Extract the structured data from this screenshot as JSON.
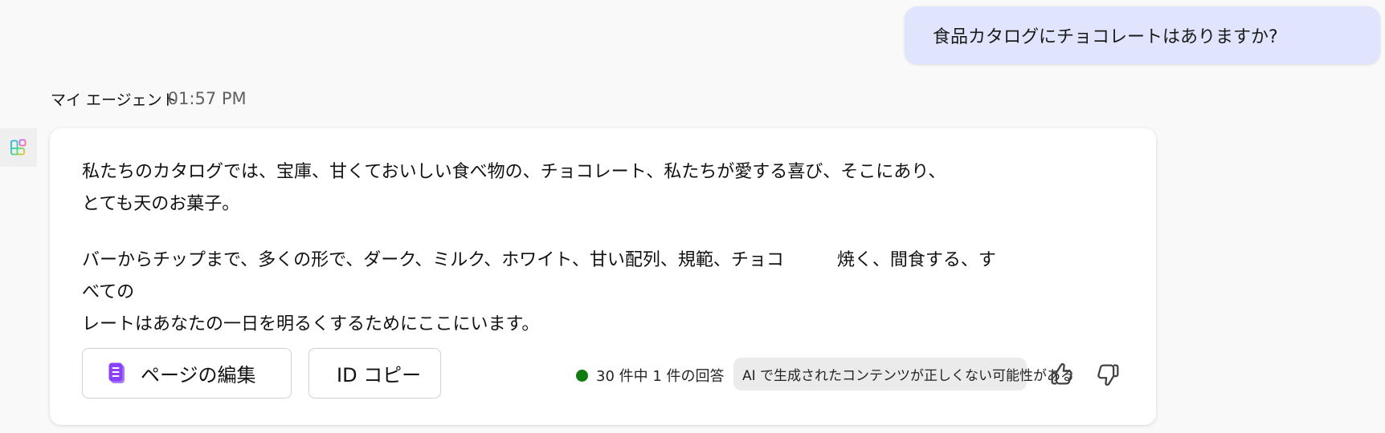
{
  "user_message": {
    "text": "食品カタログにチョコレートはありますか?"
  },
  "agent": {
    "name": "マイ エージェント",
    "time": "01:57 PM",
    "icon": "agent-apps-icon"
  },
  "response": {
    "paragraph1": {
      "line1": "私たちのカタログでは、宝庫、甘くておいしい食べ物の、チョコレート、私たちが愛する喜び、そこにあり、",
      "line2": "とても天のお菓子。"
    },
    "paragraph2": {
      "line1": "バーからチップまで、多くの形で、ダーク、ミルク、ホワイト、甘い配列、規範、チョコ　　　焼く、間食する、すべての",
      "line2": "レートはあなたの一日を明るくするためにここにいます。"
    },
    "buttons": {
      "edit_page": "ページの編集",
      "edit_page_icon": "page-edit-icon",
      "copy_id": "ID コピー"
    },
    "status": {
      "dot_color": "#107c10",
      "text": "30 件中 1 件の回答"
    },
    "disclaimer": "AI で生成されたコンテンツが正しくない可能性がある",
    "feedback": {
      "like_icon": "thumbs-up-icon",
      "dislike_icon": "thumbs-down-icon"
    }
  },
  "colors": {
    "user_bubble": "#e0e5fd",
    "accent_purple": "#8a3ffc",
    "status_green": "#107c10"
  }
}
